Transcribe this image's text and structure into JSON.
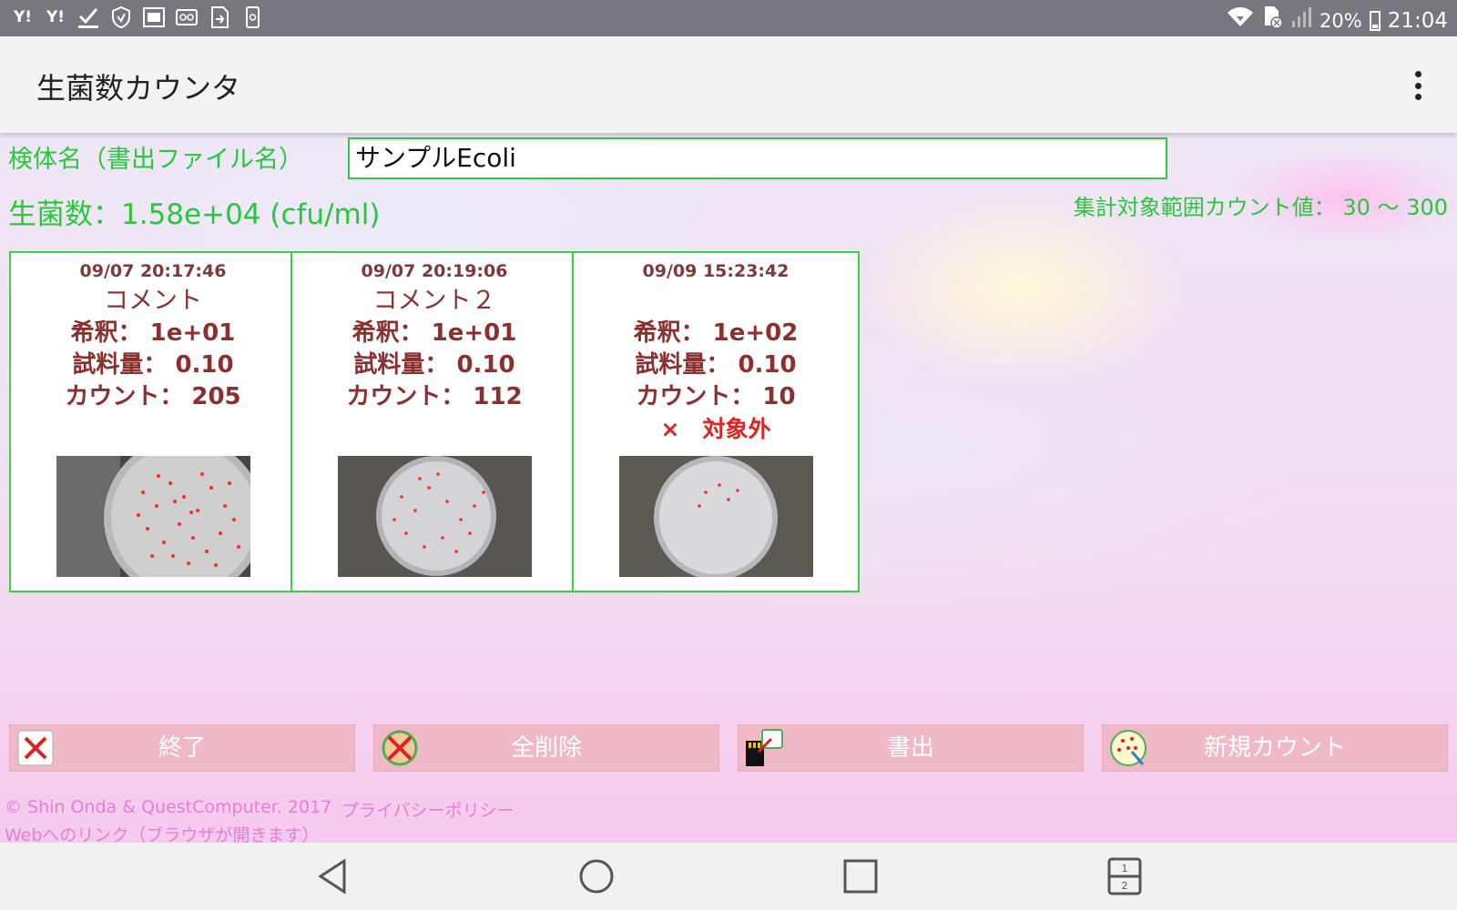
{
  "status_bar": {
    "left_icons": [
      "yahoo-icon",
      "yahoo-icon",
      "download-done-icon",
      "shield-icon",
      "au-icon",
      "voicemail-icon",
      "sim-transfer-icon",
      "phone-storage-icon"
    ],
    "yahoo_label": "Y!",
    "battery": "20%",
    "time": "21:04"
  },
  "app": {
    "title": "生菌数カウンタ"
  },
  "form": {
    "specimen_label": "検体名（書出ファイル名）",
    "specimen_value": "サンプルEcoli"
  },
  "summary": {
    "cfu": "生菌数：1.58e+04 (cfu/ml)",
    "range": "集計対象範囲カウント値： 30 ～ 300"
  },
  "cards": [
    {
      "timestamp": "09/07 20:17:46",
      "comment": "コメント",
      "dilution": "希釈： 1e+01",
      "sample_volume": "試料量： 0.10",
      "count": "カウント： 205",
      "flag": ""
    },
    {
      "timestamp": "09/07 20:19:06",
      "comment": "コメント２",
      "dilution": "希釈： 1e+01",
      "sample_volume": "試料量： 0.10",
      "count": "カウント： 112",
      "flag": ""
    },
    {
      "timestamp": "09/09 15:23:42",
      "comment": "",
      "dilution": "希釈： 1e+02",
      "sample_volume": "試料量： 0.10",
      "count": "カウント： 10",
      "flag": "×　対象外"
    }
  ],
  "buttons": {
    "exit": "終了",
    "delete_all": "全削除",
    "export": "書出",
    "new_count": "新規カウント"
  },
  "footer": {
    "copyright": "© Shin Onda & QuestComputer. 2017",
    "privacy": "プライバシーポリシー",
    "web_link": "Webへのリンク（ブラウザが開きます）"
  },
  "colors": {
    "accent_green": "#27c83a",
    "card_text": "#8b2f2f",
    "flag_red": "#e02222",
    "button_pink": "#f0b9c8",
    "link_pink": "#e47fd3"
  }
}
